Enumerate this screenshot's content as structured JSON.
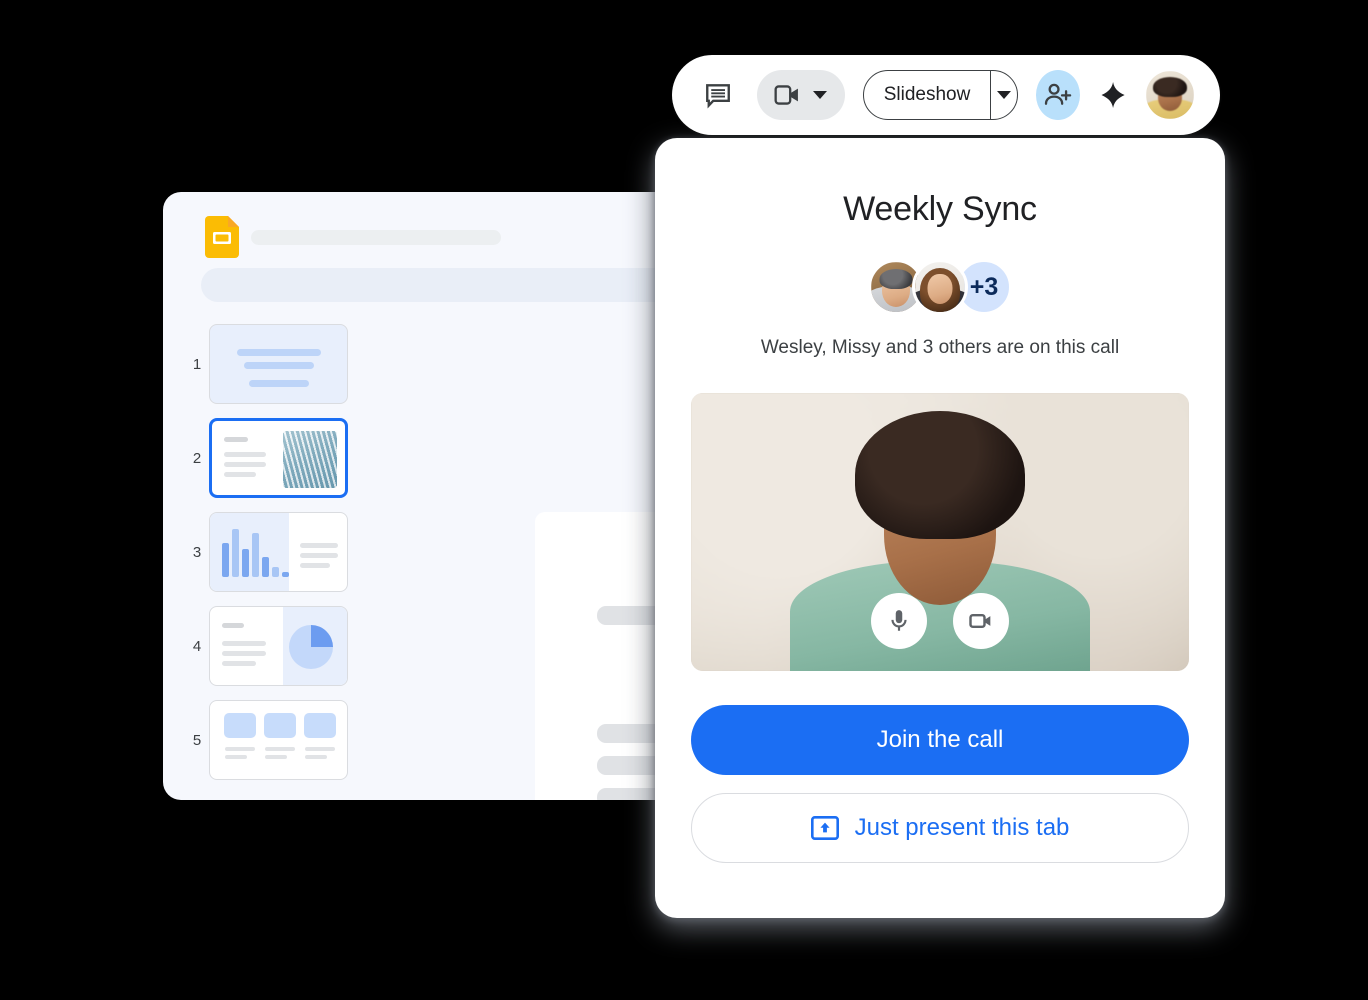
{
  "toolbar": {
    "chat_icon": "chat-bubble-icon",
    "camera_icon": "video-camera-icon",
    "camera_caret_icon": "chevron-down-icon",
    "slideshow_label": "Slideshow",
    "slideshow_caret_icon": "chevron-down-icon",
    "add_person_icon": "person-add-icon",
    "sparkle_icon": "sparkle-icon",
    "avatar_name": "user-avatar"
  },
  "slides_window": {
    "app_icon": "google-slides-icon",
    "title_placeholder": "",
    "toolbar_placeholder": "",
    "thumbnails": [
      {
        "number": "1",
        "layout": "title-slide"
      },
      {
        "number": "2",
        "layout": "text-image",
        "selected": true
      },
      {
        "number": "3",
        "layout": "bar-chart-text"
      },
      {
        "number": "4",
        "layout": "text-pie-chart"
      },
      {
        "number": "5",
        "layout": "three-cards"
      }
    ]
  },
  "meet_card": {
    "title": "Weekly Sync",
    "plus_count": "+3",
    "participants_text": "Wesley, Missy and 3 others are on this call",
    "avatars": [
      "wesley-avatar",
      "missy-avatar"
    ],
    "video": {
      "self_view": "self-video-preview",
      "mic_icon": "microphone-icon",
      "camera_icon": "video-camera-icon"
    },
    "join_label": "Join the call",
    "present_label": "Just present this tab",
    "present_icon": "present-to-tab-icon"
  },
  "colors": {
    "accent_blue": "#1b6ef3",
    "chip_blue": "#d3e3fd",
    "add_person_blue": "#b9e0fb",
    "slides_yellow": "#fbbc04",
    "window_bg": "#f6f8fd"
  }
}
